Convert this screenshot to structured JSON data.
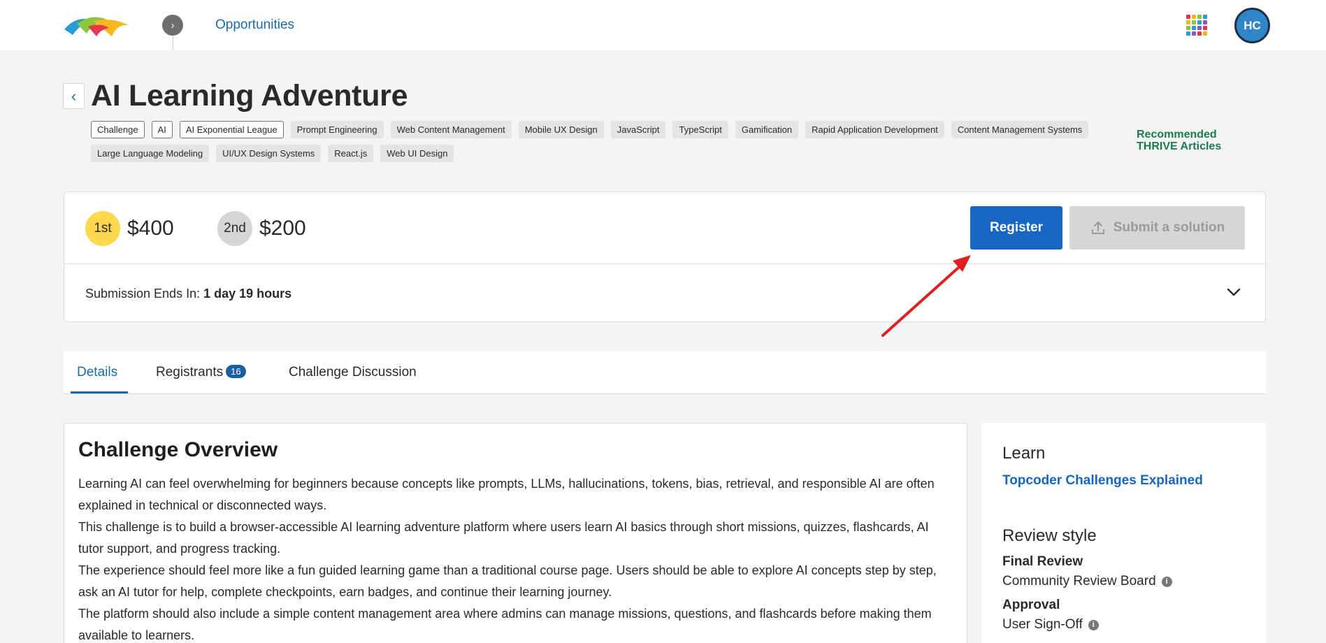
{
  "nav": {
    "link": "Opportunities",
    "avatar_initials": "HC"
  },
  "challenge": {
    "title": "AI Learning Adventure",
    "tags_outline": [
      "Challenge",
      "AI",
      "AI Exponential League"
    ],
    "tags": [
      "Prompt Engineering",
      "Web Content Management",
      "Mobile UX Design",
      "JavaScript",
      "TypeScript",
      "Gamification",
      "Rapid Application Development",
      "Content Management Systems",
      "Large Language Modeling",
      "UI/UX Design Systems",
      "React.js",
      "Web UI Design"
    ],
    "thrive_link": "Recommended THRIVE Articles"
  },
  "prizes": {
    "first_place": "1st",
    "first_amount": "$400",
    "second_place": "2nd",
    "second_amount": "$200",
    "register_label": "Register",
    "submit_label": "Submit a solution",
    "submission_label": "Submission Ends In: ",
    "submission_value": "1 day 19 hours"
  },
  "tabs": {
    "details": "Details",
    "registrants": "Registrants",
    "registrants_count": "16",
    "discussion": "Challenge Discussion"
  },
  "overview": {
    "heading": "Challenge Overview",
    "paragraphs": [
      "Learning AI can feel overwhelming for beginners because concepts like prompts, LLMs, hallucinations, tokens, bias, retrieval, and responsible AI are often explained in technical or disconnected ways.",
      "This challenge is to build a browser-accessible AI learning adventure platform where users learn AI basics through short missions, quizzes, flashcards, AI tutor support, and progress tracking.",
      "The experience should feel more like a fun guided learning game than a traditional course page. Users should be able to explore AI concepts step by step, ask an AI tutor for help, complete checkpoints, earn badges, and continue their learning journey.",
      "The platform should also include a simple content management area where admins can manage missions, questions, and flashcards before making them available to learners."
    ]
  },
  "sidebar": {
    "learn_heading": "Learn",
    "learn_link": "Topcoder Challenges Explained",
    "review_heading": "Review style",
    "final_review_label": "Final Review",
    "final_review_value": "Community Review Board",
    "approval_label": "Approval",
    "approval_value": "User Sign-Off"
  },
  "colors": {
    "primary": "#1666c2",
    "link": "#1a6aa8",
    "thrive": "#1a7c4e",
    "gold": "#ffd84d",
    "silver": "#d6d6d6",
    "annotation": "#e02020"
  }
}
